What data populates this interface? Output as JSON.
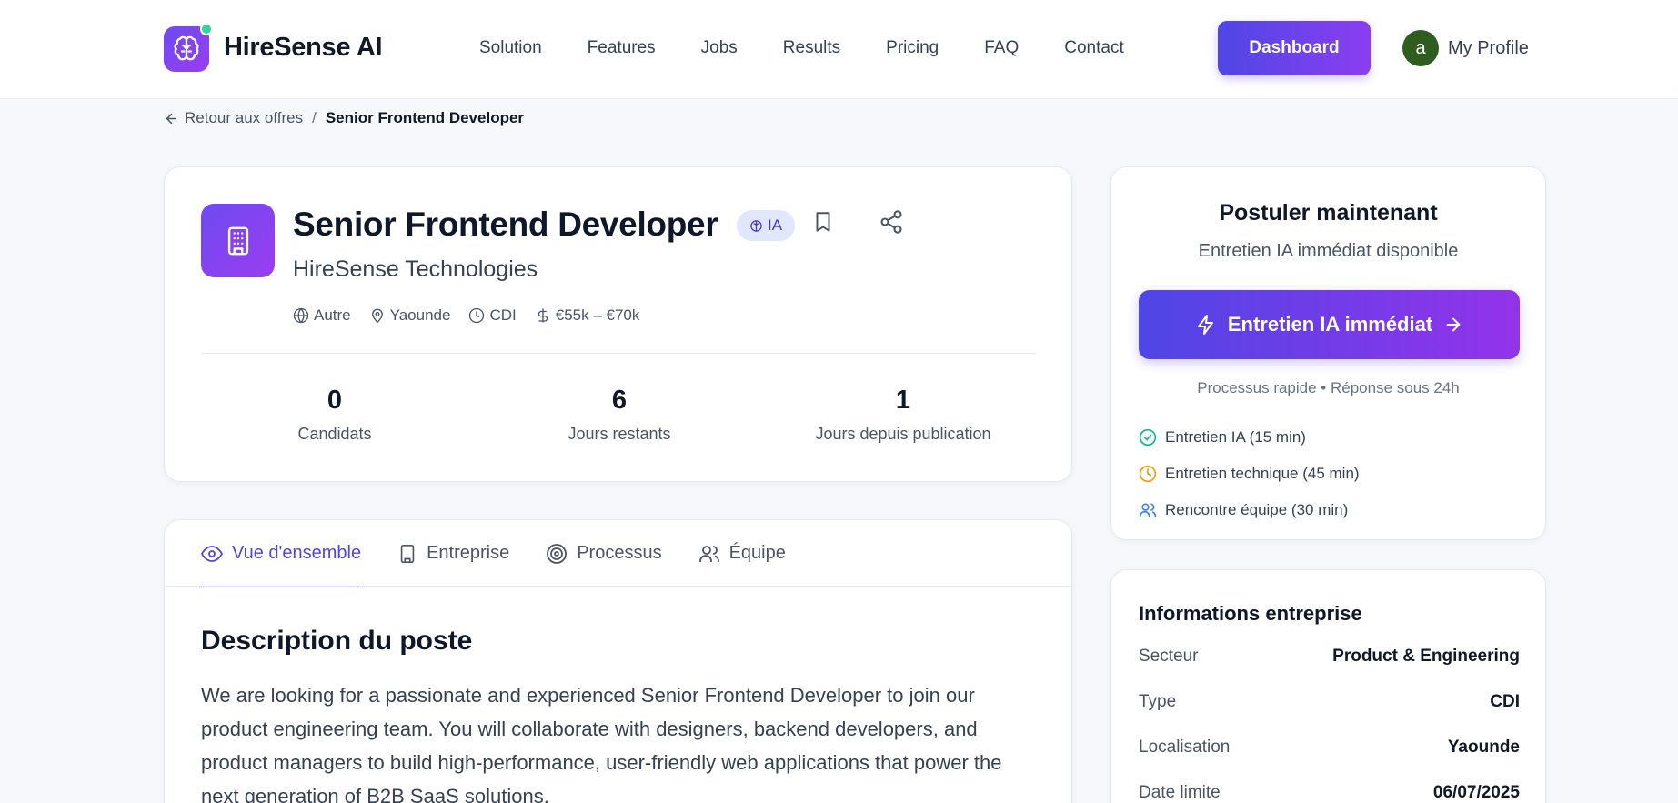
{
  "header": {
    "brand": "HireSense AI",
    "nav": [
      "Solution",
      "Features",
      "Jobs",
      "Results",
      "Pricing",
      "FAQ",
      "Contact"
    ],
    "dashboard_label": "Dashboard",
    "avatar_initial": "a",
    "profile_label": "My Profile",
    "accent_color": "#4f46e5"
  },
  "breadcrumb": {
    "back_label": "Retour aux offres",
    "separator": "/",
    "current": "Senior Frontend Developer"
  },
  "job": {
    "title": "Senior Frontend Developer",
    "badge": "IA",
    "company": "HireSense Technologies",
    "meta": {
      "sector": "Autre",
      "location": "Yaounde",
      "contract": "CDI",
      "salary": "€55k – €70k"
    },
    "stats": [
      {
        "value": "0",
        "label": "Candidats"
      },
      {
        "value": "6",
        "label": "Jours restants"
      },
      {
        "value": "1",
        "label": "Jours depuis publication"
      }
    ]
  },
  "tabs": [
    {
      "label": "Vue d'ensemble",
      "icon": "eye-icon",
      "active": true
    },
    {
      "label": "Entreprise",
      "icon": "building-icon",
      "active": false
    },
    {
      "label": "Processus",
      "icon": "target-icon",
      "active": false
    },
    {
      "label": "Équipe",
      "icon": "users-icon",
      "active": false
    }
  ],
  "description": {
    "title": "Description du poste",
    "text": "We are looking for a passionate and experienced Senior Frontend Developer to join our product engineering team. You will collaborate with designers, backend developers, and product managers to build high-performance, user-friendly web applications that power the next generation of B2B SaaS solutions."
  },
  "apply": {
    "title": "Postuler maintenant",
    "subtitle": "Entretien IA immédiat disponible",
    "button_label": "Entretien IA immédiat",
    "note": "Processus rapide • Réponse sous 24h",
    "steps": [
      {
        "label": "Entretien IA (15 min)",
        "icon": "check-circle-icon",
        "color": "#10b981"
      },
      {
        "label": "Entretien technique (45 min)",
        "icon": "clock-icon",
        "color": "#f59e0b"
      },
      {
        "label": "Rencontre équipe (30 min)",
        "icon": "users-icon",
        "color": "#3b82f6"
      }
    ]
  },
  "company_info": {
    "title": "Informations entreprise",
    "rows": [
      {
        "key": "Secteur",
        "value": "Product & Engineering"
      },
      {
        "key": "Type",
        "value": "CDI"
      },
      {
        "key": "Localisation",
        "value": "Yaounde"
      },
      {
        "key": "Date limite",
        "value": "06/07/2025"
      }
    ]
  }
}
